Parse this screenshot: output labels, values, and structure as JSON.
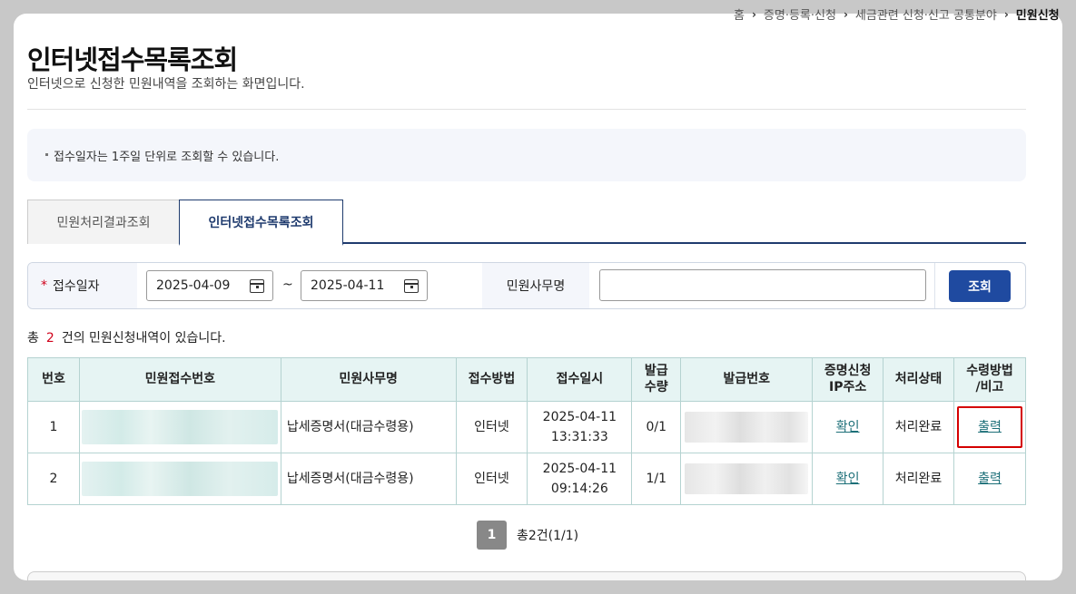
{
  "breadcrumb": {
    "items": [
      "홈",
      "증명·등록·신청",
      "세금관련 신청·신고 공통분야",
      "민원신청"
    ]
  },
  "page": {
    "title": "인터넷접수목록조회",
    "subtitle": "인터넷으로 신청한 민원내역을 조회하는 화면입니다."
  },
  "notice": {
    "text": "접수일자는 1주일 단위로 조회할 수 있습니다."
  },
  "tabs": [
    {
      "label": "민원처리결과조회",
      "active": false
    },
    {
      "label": "인터넷접수목록조회",
      "active": true
    }
  ],
  "search": {
    "required_mark": "*",
    "date_label": "접수일자",
    "date_from": "2025-04-09",
    "date_separator": "~",
    "date_to": "2025-04-11",
    "name_label": "민원사무명",
    "name_value": "",
    "button_label": "조회"
  },
  "summary": {
    "prefix": "총",
    "count": "2",
    "suffix": "건의 민원신청내역이 있습니다."
  },
  "table": {
    "headers": [
      "번호",
      "민원접수번호",
      "민원사무명",
      "접수방법",
      "접수일시",
      "발급\n수량",
      "발급번호",
      "증명신청\nIP주소",
      "처리상태",
      "수령방법\n/비고"
    ],
    "rows": [
      {
        "no": "1",
        "name": "납세증명서(대금수령용)",
        "method": "인터넷",
        "date": "2025-04-11",
        "time": "13:31:33",
        "qty": "0/1",
        "ip_link": "확인",
        "status": "처리완료",
        "action": "출력"
      },
      {
        "no": "2",
        "name": "납세증명서(대금수령용)",
        "method": "인터넷",
        "date": "2025-04-11",
        "time": "09:14:26",
        "qty": "1/1",
        "ip_link": "확인",
        "status": "처리완료",
        "action": "출력"
      }
    ]
  },
  "pagination": {
    "current": "1",
    "info": "총2건(1/1)"
  },
  "colors": {
    "brand": "#1f3b6e",
    "button": "#1f4aa0",
    "table_header": "#e6f4f3",
    "link": "#1c6f78",
    "highlight": "#d40000"
  }
}
